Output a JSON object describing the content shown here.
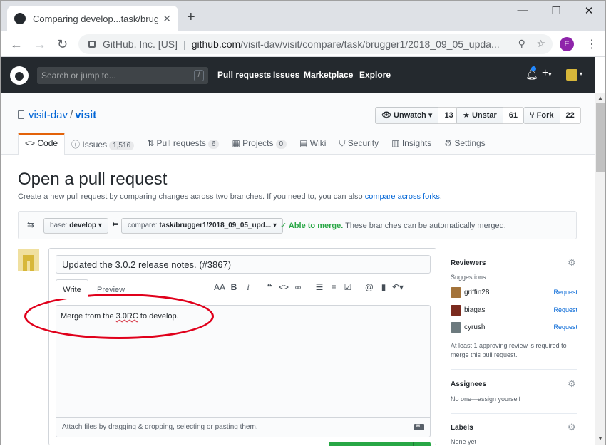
{
  "browser": {
    "tab_title": "Comparing develop...task/brugge",
    "tab_close": "✕",
    "new_tab": "+",
    "window_controls": {
      "minimize": "—",
      "maximize": "☐",
      "close": "✕"
    },
    "nav": {
      "back": "←",
      "forward": "→",
      "reload": "↻"
    },
    "owner": "GitHub, Inc. [US]",
    "separator": "|",
    "url_host": "github.com",
    "url_path": "/visit-dav/visit/compare/task/brugger1/2018_09_05_upda...",
    "profile_initial": "E",
    "menu": "⋮"
  },
  "gh_header": {
    "search_placeholder": "Search or jump to...",
    "search_shortcut": "/",
    "nav": [
      "Pull requests",
      "Issues",
      "Marketplace",
      "Explore"
    ],
    "plus": "+",
    "caret": "▾"
  },
  "repo": {
    "owner": "visit-dav",
    "separator": "/",
    "name": "visit",
    "watch_label": "Unwatch",
    "watch_count": "13",
    "star_label": "Unstar",
    "star_count": "61",
    "fork_label": "Fork",
    "fork_count": "22",
    "tabs": {
      "code": "Code",
      "issues": "Issues",
      "issues_count": "1,516",
      "pulls": "Pull requests",
      "pulls_count": "6",
      "projects": "Projects",
      "projects_count": "0",
      "wiki": "Wiki",
      "security": "Security",
      "insights": "Insights",
      "settings": "Settings"
    }
  },
  "compare": {
    "heading": "Open a pull request",
    "subtitle": "Create a new pull request by comparing changes across two branches. If you need to, you can also",
    "subtitle_link": "compare across forks",
    "subtitle_end": ".",
    "base_label": "base:",
    "base_branch": "develop",
    "compare_label": "compare:",
    "compare_branch": "task/brugger1/2018_09_05_upd...",
    "merge_ok": "✓ Able to merge.",
    "merge_text": "These branches can be automatically merged."
  },
  "pr_form": {
    "title_value": "Updated the 3.0.2 release notes. (#3867)",
    "tab_write": "Write",
    "tab_preview": "Preview",
    "body_before": "Merge from the ",
    "body_misspelled": "3.0RC",
    "body_after": " to develop.",
    "attach_text": "Attach files by dragging & dropping, selecting or pasting them.",
    "md_badge": "M↓"
  },
  "sidebar": {
    "reviewers_heading": "Reviewers",
    "suggestions": "Suggestions",
    "reviewers": [
      {
        "name": "griffin28",
        "action": "Request",
        "color": "#a3733a"
      },
      {
        "name": "biagas",
        "action": "Request",
        "color": "#7a2a1e"
      },
      {
        "name": "cyrush",
        "action": "Request",
        "color": "#6c7a7e"
      }
    ],
    "review_note_1": "At least 1 approving review is required to",
    "review_note_2": "merge this pull request.",
    "assignees_heading": "Assignees",
    "assignees_text": "No one—assign yourself",
    "labels_heading": "Labels",
    "labels_text": "None yet"
  },
  "colors": {
    "github_header": "#24292e",
    "link": "#0366d6",
    "success": "#28a745",
    "tab_accent": "#e36209",
    "annotation_ellipse": "#e0001b"
  }
}
